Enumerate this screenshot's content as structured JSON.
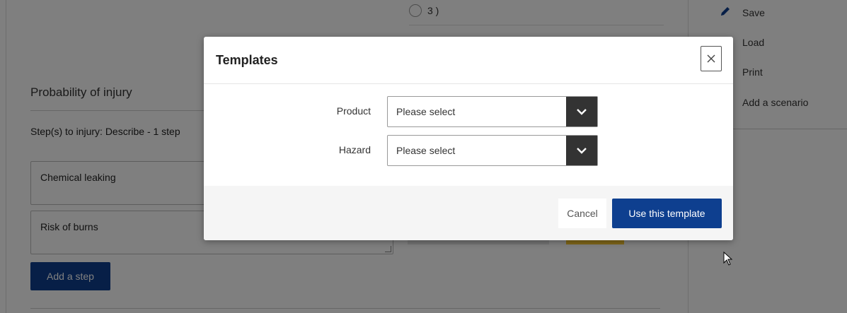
{
  "background": {
    "radio_option_label": "3 )",
    "section_title": "Probability of injury",
    "steps_label": "Step(s) to injury: Describe - 1 step",
    "steps": [
      {
        "text": "Chemical leaking"
      },
      {
        "text": "Risk of burns"
      }
    ],
    "add_step_label": "Add a step"
  },
  "sidebar": {
    "items": [
      {
        "label": "Save",
        "icon": "pencil-icon"
      },
      {
        "label": "Load"
      },
      {
        "label": "Print"
      },
      {
        "label": "Add a scenario"
      }
    ]
  },
  "modal": {
    "title": "Templates",
    "close_icon": "close-icon",
    "fields": [
      {
        "label": "Product",
        "value": "Please select"
      },
      {
        "label": "Hazard",
        "value": "Please select"
      }
    ],
    "cancel_label": "Cancel",
    "submit_label": "Use this template"
  },
  "colors": {
    "primary": "#0e3f8f",
    "select_arrow_bg": "#333333",
    "accent_yellow": "#ffcc33"
  }
}
